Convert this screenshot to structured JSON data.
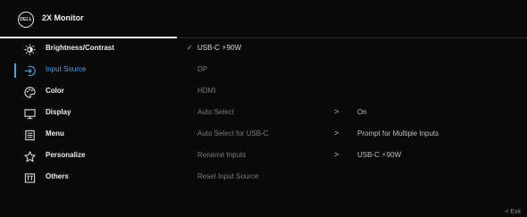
{
  "header": {
    "logo_text": "DELL",
    "title": "2X Monitor"
  },
  "sidebar": {
    "items": [
      {
        "label": "Brightness/Contrast",
        "icon": "brightness-icon"
      },
      {
        "label": "Input Source",
        "icon": "input-source-icon",
        "active": true
      },
      {
        "label": "Color",
        "icon": "color-palette-icon"
      },
      {
        "label": "Display",
        "icon": "display-icon"
      },
      {
        "label": "Menu",
        "icon": "menu-icon"
      },
      {
        "label": "Personalize",
        "icon": "star-icon"
      },
      {
        "label": "Others",
        "icon": "others-icon"
      }
    ]
  },
  "options": {
    "items": [
      {
        "label": "USB-C ⚡90W",
        "selected": true,
        "check": "✓"
      },
      {
        "label": "DP"
      },
      {
        "label": "HDMI"
      },
      {
        "label": "Auto Select",
        "arrow": ">",
        "value": "On"
      },
      {
        "label": "Auto Select for USB-C",
        "arrow": ">",
        "value": "Prompt for Multiple Inputs"
      },
      {
        "label": "Rename Inputs",
        "arrow": ">",
        "value": "USB-C ⚡90W"
      },
      {
        "label": "Reset Input Source"
      }
    ]
  },
  "footer": {
    "exit_label": "< Exit"
  },
  "colors": {
    "accent": "#4aa3df",
    "background": "#0a0a0a"
  }
}
